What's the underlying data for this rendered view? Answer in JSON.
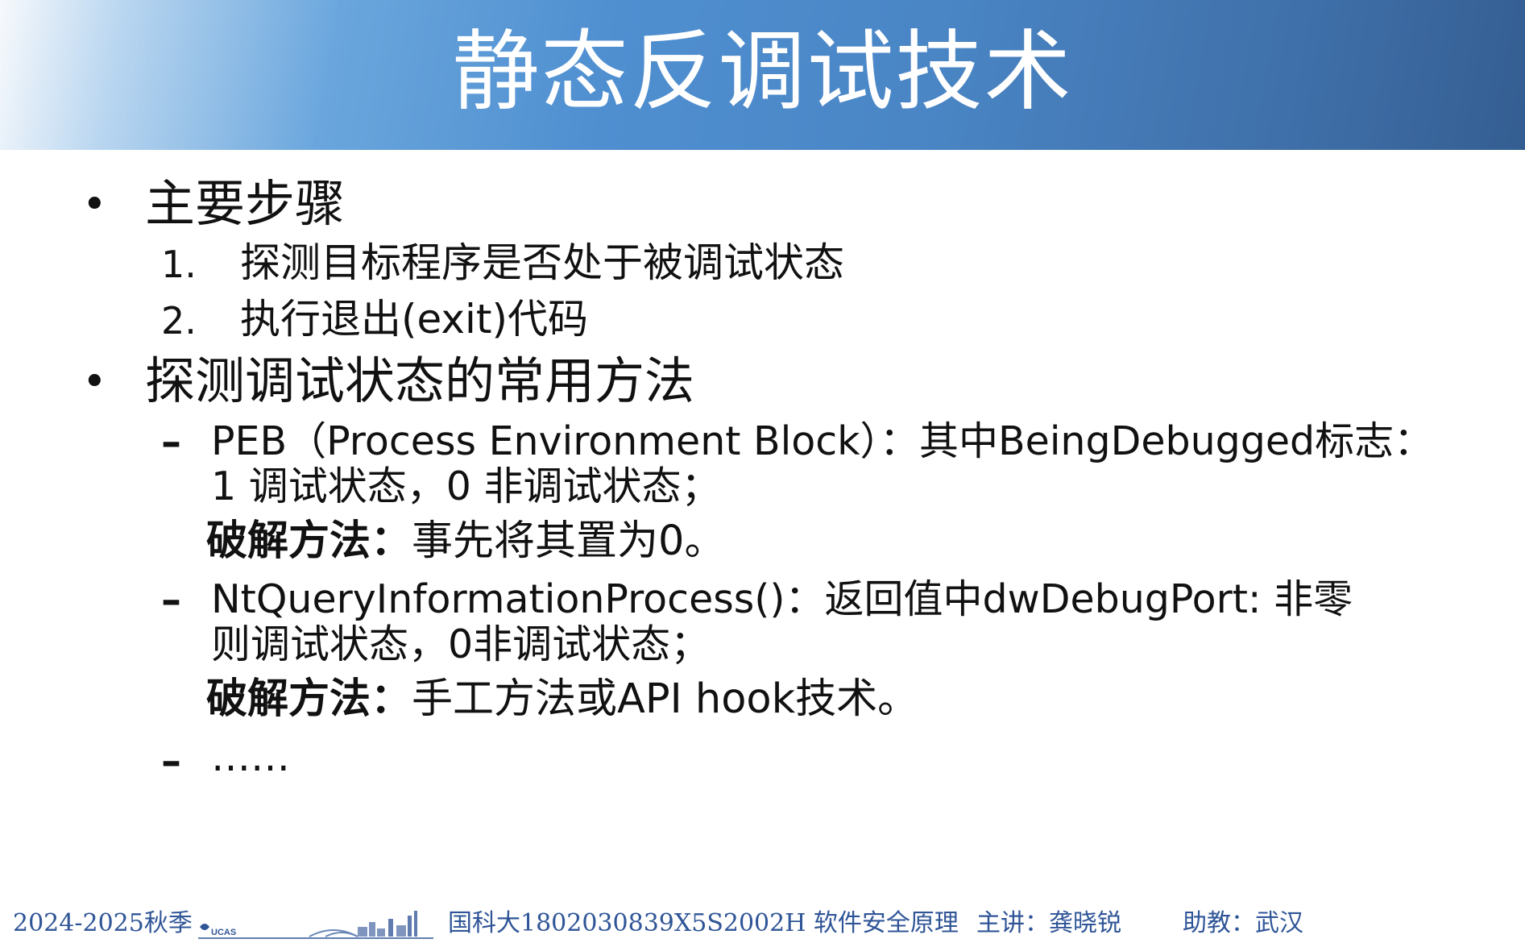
{
  "slide": {
    "title": "静态反调试技术",
    "main_steps": {
      "heading": "主要步骤",
      "items": [
        {
          "num": "1.",
          "text": "探测目标程序是否处于被调试状态"
        },
        {
          "num": "2.",
          "text": "执行退出(exit)代码"
        }
      ]
    },
    "methods": {
      "heading": "探测调试状态的常用方法",
      "items": [
        {
          "dash": "–",
          "line1": "PEB（Process Environment Block）：其中BeingDebugged标志：",
          "line2": "1 调试状态，0 非调试状态；",
          "crack_label": "破解方法：",
          "crack_text": "事先将其置为0。"
        },
        {
          "dash": "–",
          "line1": "NtQueryInformationProcess()：返回值中dwDebugPort: 非零",
          "line2": "则调试状态，0非调试状态；",
          "crack_label": "破解方法：",
          "crack_text": "手工方法或API hook技术。"
        },
        {
          "dash": "–",
          "line1": "……"
        }
      ]
    },
    "bullet_symbol": "•"
  },
  "footer": {
    "term": "2024-2025秋季",
    "logo_text": "UCAS",
    "course": "国科大1802030839X5S2002H 软件安全原理",
    "lecturer": "主讲：龚晓锐",
    "assistant": "助教：武汉"
  },
  "colors": {
    "header_gradient_start": "#f7f9fc",
    "header_gradient_mid": "#4f8fd0",
    "header_gradient_end": "#345e92",
    "footer_text": "#2f5597",
    "body_text": "#111111"
  }
}
